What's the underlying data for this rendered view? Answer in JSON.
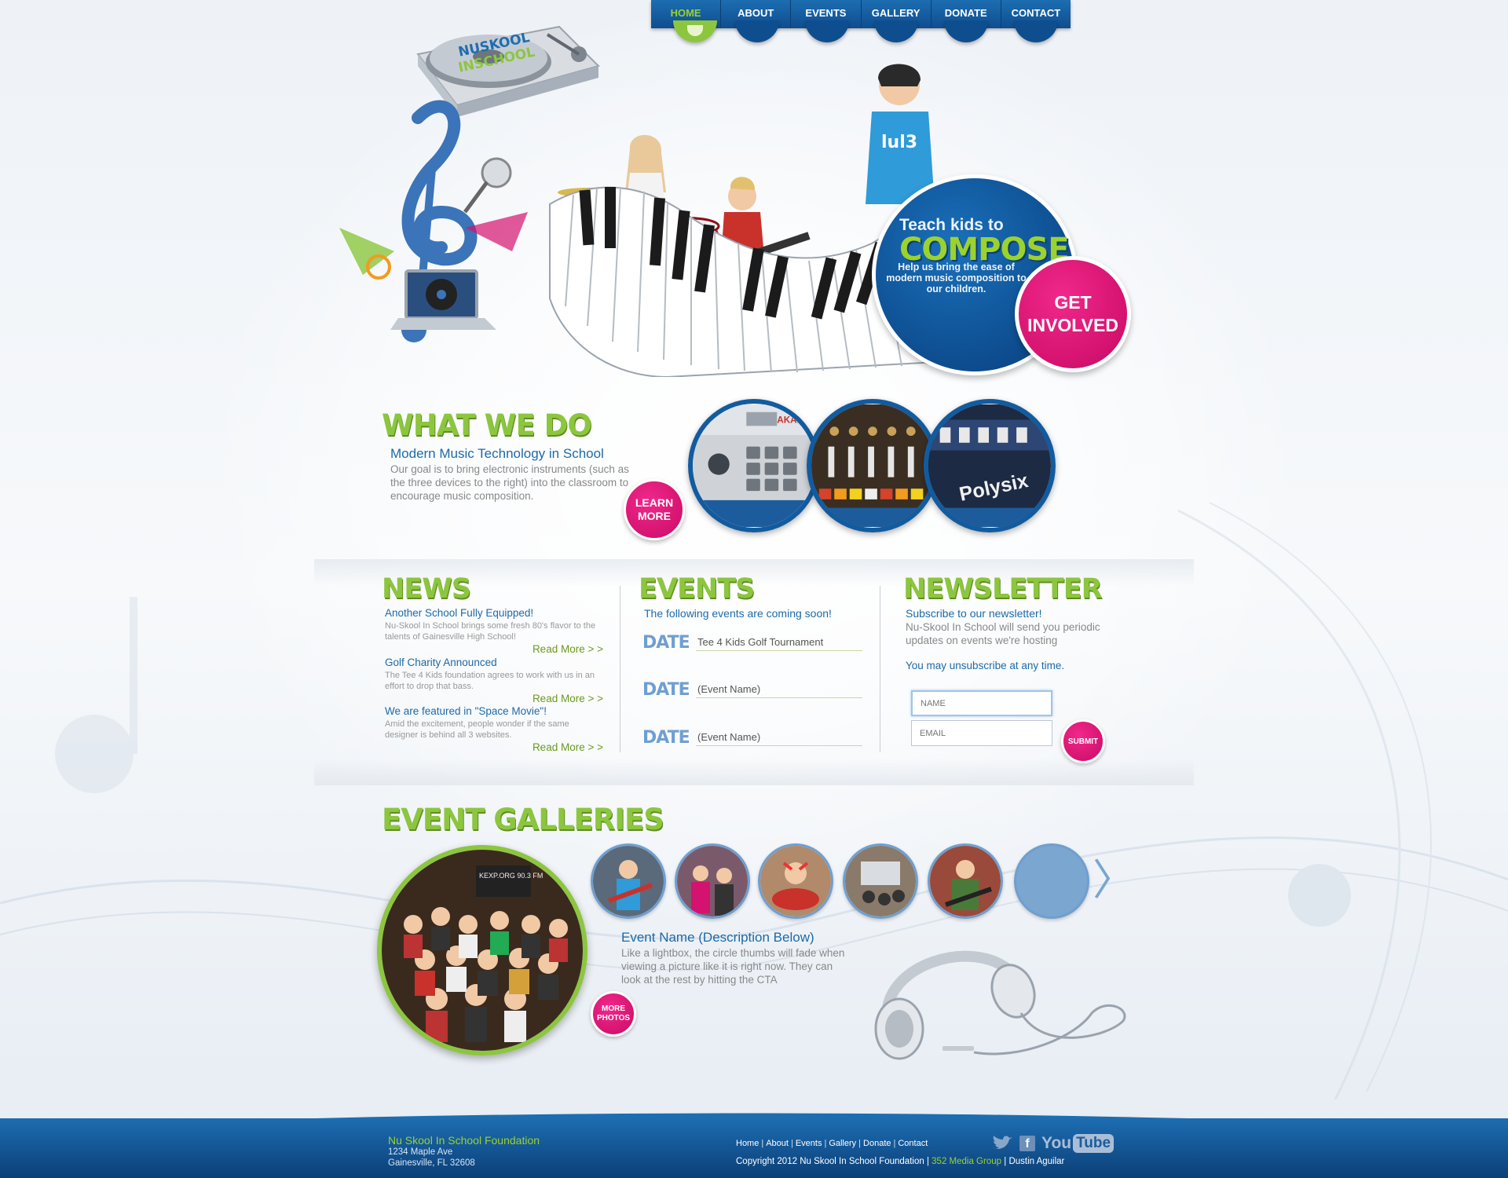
{
  "nav": {
    "items": [
      {
        "label": "HOME",
        "active": true
      },
      {
        "label": "ABOUT",
        "active": false
      },
      {
        "label": "EVENTS",
        "active": false
      },
      {
        "label": "GALLERY",
        "active": false
      },
      {
        "label": "DONATE",
        "active": false
      },
      {
        "label": "CONTACT",
        "active": false
      }
    ]
  },
  "hero": {
    "logo_text": "NUSKOOL INSCHOOL",
    "headline_1": "Teach kids to",
    "headline_2": "COMPOSE",
    "description": "Help us bring the ease of modern music composition to our children.",
    "cta": "GET INVOLVED"
  },
  "what_we_do": {
    "title": "WHAT WE DO",
    "subtitle": "Modern Music Technology in School",
    "text": "Our goal is to bring electronic instruments (such as the three devices to the right) into the classroom to encourage music composition.",
    "cta": "LEARN MORE",
    "device_labels": [
      "AKAI",
      "Polysix"
    ]
  },
  "news": {
    "title": "NEWS",
    "items": [
      {
        "headline": "Another School Fully Equipped!",
        "body": "Nu-Skool In School brings some fresh 80's flavor to the talents of Gainesville High School!",
        "more": "Read More > >"
      },
      {
        "headline": "Golf Charity Announced",
        "body": "The Tee 4 Kids foundation agrees to work with us in an effort to drop that bass.",
        "more": "Read More > >"
      },
      {
        "headline": "We are featured in \"Space Movie\"!",
        "body": "Amid the excitement, people wonder if the same designer is behind all 3 websites.",
        "more": "Read More > >"
      }
    ]
  },
  "events": {
    "title": "EVENTS",
    "intro": "The following events are coming soon!",
    "items": [
      {
        "date": "DATE",
        "name": "Tee 4 Kids Golf Tournament"
      },
      {
        "date": "DATE",
        "name": "(Event Name)"
      },
      {
        "date": "DATE",
        "name": "(Event Name)"
      }
    ]
  },
  "newsletter": {
    "title": "NEWSLETTER",
    "subtitle": "Subscribe to our newsletter!",
    "text": "Nu-Skool In School will send you periodic updates on events we're hosting",
    "unsubscribe": "You may unsubscribe at any time.",
    "name_placeholder": "NAME",
    "email_placeholder": "EMAIL",
    "submit": "SUBMIT"
  },
  "galleries": {
    "title": "EVENT GALLERIES",
    "radio_sign": "KEXP.ORG 90.3 FM",
    "event_name": "Event Name (Description Below)",
    "event_desc": "Like a lightbox, the circle thumbs will fade when viewing a picture like it is right now. They can look at the rest by hitting the CTA",
    "more_photos": "MORE PHOTOS",
    "prev": "〈",
    "next": "〉"
  },
  "footer": {
    "org": "Nu Skool In School Foundation",
    "address_1": "1234 Maple Ave",
    "address_2": "Gainesville, FL 32608",
    "links": [
      "Home",
      "About",
      "Events",
      "Gallery",
      "Donate",
      "Contact"
    ],
    "link_separator": "|",
    "copyright": "Copyright 2012 Nu Skool In School Foundation",
    "credit_agency": "352 Media Group",
    "credit_designer": "Dustin Aguilar",
    "credit_separator": "|",
    "youtube_label": "You",
    "youtube_tube": "Tube",
    "facebook_label": "f"
  },
  "colors": {
    "brand_blue": "#0e4e8f",
    "brand_green": "#8cc63f",
    "brand_pink": "#d4126f"
  }
}
